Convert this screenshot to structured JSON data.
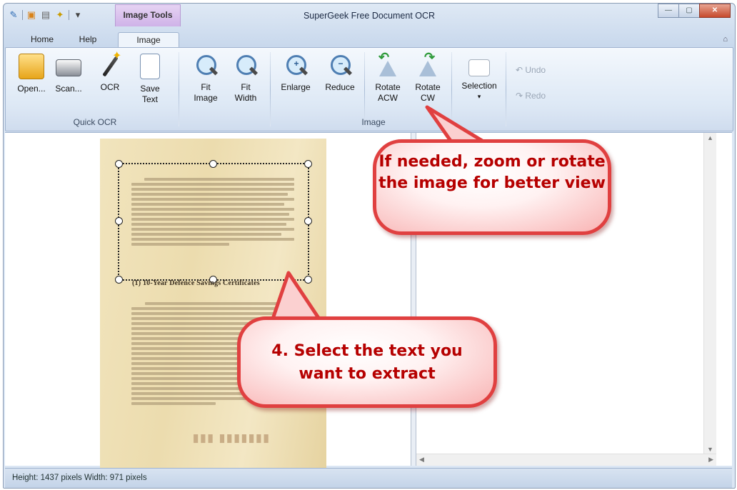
{
  "titlebar": {
    "app_title": "SuperGeek Free Document OCR",
    "context_tab": "Image Tools",
    "qat_dropdown": "▾",
    "win_min": "—",
    "win_max": "▢",
    "win_close": "✕"
  },
  "tabs": {
    "home": "Home",
    "help": "Help",
    "image": "Image",
    "help_marker": "⌂"
  },
  "ribbon": {
    "quick_ocr": {
      "group_label": "Quick OCR",
      "open": "Open...",
      "scan": "Scan...",
      "ocr": "OCR",
      "save_text_1": "Save",
      "save_text_2": "Text"
    },
    "image": {
      "group_label": "Image",
      "fit_image_1": "Fit",
      "fit_image_2": "Image",
      "fit_width_1": "Fit",
      "fit_width_2": "Width",
      "enlarge": "Enlarge",
      "reduce": "Reduce",
      "rotate_acw_1": "Rotate",
      "rotate_acw_2": "ACW",
      "rotate_cw_1": "Rotate",
      "rotate_cw_2": "CW",
      "selection": "Selection",
      "selection_arrow": "▾",
      "undo": "Undo",
      "redo": "Redo"
    }
  },
  "document": {
    "section_heading": "(1) 10-Year Defence Savings Certificates"
  },
  "callouts": {
    "zoom_rotate": "If needed, zoom or rotate the image for better view",
    "select_text": "4. Select the text you want to extract"
  },
  "status": {
    "text": "Height: 1437 pixels  Width: 971 pixels"
  },
  "colors": {
    "callout_border": "#e04040",
    "callout_text": "#b60000",
    "context_tab": "#cfb2e8"
  }
}
